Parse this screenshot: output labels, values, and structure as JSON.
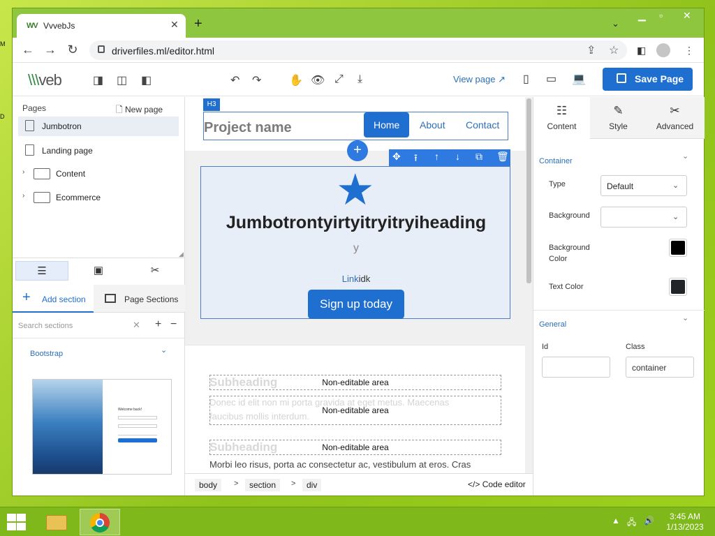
{
  "browser": {
    "tab_title": "VvvebJs",
    "tab_favicon": "WV",
    "url": "driverfiles.ml/editor.html"
  },
  "editor": {
    "logo_prefix": "\\\\\\",
    "logo_text": "veb",
    "view_page": "View page",
    "save_label": "Save Page"
  },
  "left": {
    "pages_header": "Pages",
    "new_page": "New page",
    "pages": [
      {
        "label": "Jumbotron"
      },
      {
        "label": "Landing page"
      }
    ],
    "folders": [
      {
        "label": "Content"
      },
      {
        "label": "Ecommerce"
      }
    ],
    "add_section": "Add section",
    "page_sections": "Page Sections",
    "search_placeholder": "Search sections",
    "group": "Bootstrap",
    "thumb_text": "Welcome back!"
  },
  "canvas": {
    "h3_tag": "H3",
    "project_name": "Project name",
    "nav": [
      "Home",
      "About",
      "Contact"
    ],
    "jumbo_title": "Jumbotrontyirtyitryitryiheading",
    "jumbo_sub": "y",
    "jumbo_link": "Link",
    "jumbo_link_suffix": "idk",
    "jumbo_button": "Sign up today",
    "non_editable": "Non-editable area",
    "subheading": "Subheading",
    "ghost_paragraph": "Donec id elit non mi porta gravida at eget metus. Maecenas faucibus mollis interdum.",
    "morbi": "Morbi leo risus, porta ac consectetur ac, vestibulum at eros. Cras"
  },
  "breadcrumb": [
    "body",
    "section",
    "div"
  ],
  "code_editor": "Code editor",
  "right": {
    "tabs": [
      "Content",
      "Style",
      "Advanced"
    ],
    "container_title": "Container",
    "type_label": "Type",
    "type_value": "Default",
    "background_label": "Background",
    "background_value": "",
    "bgcolor_label": "Background Color",
    "textcolor_label": "Text Color",
    "bgcolor": "#000000",
    "textcolor": "#212529",
    "general_title": "General",
    "id_label": "Id",
    "id_value": "",
    "class_label": "Class",
    "class_value": "container"
  },
  "taskbar": {
    "time": "3:45 AM",
    "date": "1/13/2023"
  },
  "colors": {
    "accent": "#1f6fd0",
    "desktop": "#a9d22a"
  }
}
